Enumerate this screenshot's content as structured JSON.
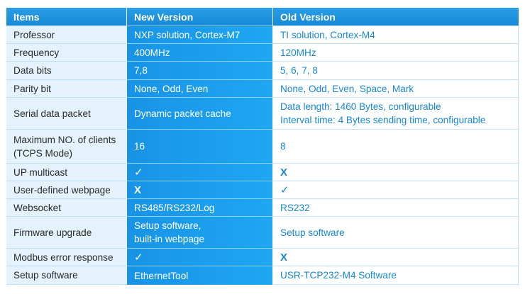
{
  "headers": {
    "items": "Items",
    "new_version": "New Version",
    "old_version": "Old Version"
  },
  "rows": [
    {
      "item": "Professor",
      "new": [
        "NXP solution, Cortex-M7"
      ],
      "old": [
        "TI solution, Cortex-M4"
      ]
    },
    {
      "item": "Frequency",
      "new": [
        "400MHz"
      ],
      "old": [
        "120MHz"
      ]
    },
    {
      "item": "Data bits",
      "new": [
        "7,8"
      ],
      "old": [
        "5, 6, 7, 8"
      ]
    },
    {
      "item": "Parity bit",
      "new": [
        "None, Odd, Even"
      ],
      "old": [
        "None, Odd, Even, Space, Mark"
      ]
    },
    {
      "item": "Serial data packet",
      "new": [
        "Dynamic packet cache"
      ],
      "old": [
        "Data length: 1460 Bytes, configurable",
        "Interval time: 4 Bytes sending time, configurable"
      ]
    },
    {
      "item": [
        "Maximum NO. of clients",
        "(TCPS Mode)"
      ],
      "new": [
        "16"
      ],
      "old": [
        "8"
      ]
    },
    {
      "item": "UP multicast",
      "new": [
        "✓"
      ],
      "old": [
        "X"
      ]
    },
    {
      "item": "User-defined webpage",
      "new": [
        "X"
      ],
      "old": [
        "✓"
      ]
    },
    {
      "item": "Websocket",
      "new": [
        "RS485/RS232/Log"
      ],
      "old": [
        "RS232"
      ]
    },
    {
      "item": "Firmware upgrade",
      "new": [
        "Setup software,",
        "built-in webpage"
      ],
      "old": [
        "Setup software"
      ]
    },
    {
      "item": "Modbus error response",
      "new": [
        "✓"
      ],
      "old": [
        "X"
      ]
    },
    {
      "item": "Setup software",
      "new": [
        "EthernetTool"
      ],
      "old": [
        "USR-TCP232-M4 Software"
      ]
    }
  ],
  "colors": {
    "header_blue": "#1e93e0",
    "new_column_blue": "#1aa0ee",
    "item_column_bg": "#e3f2fc",
    "old_text_blue": "#1787d6"
  }
}
